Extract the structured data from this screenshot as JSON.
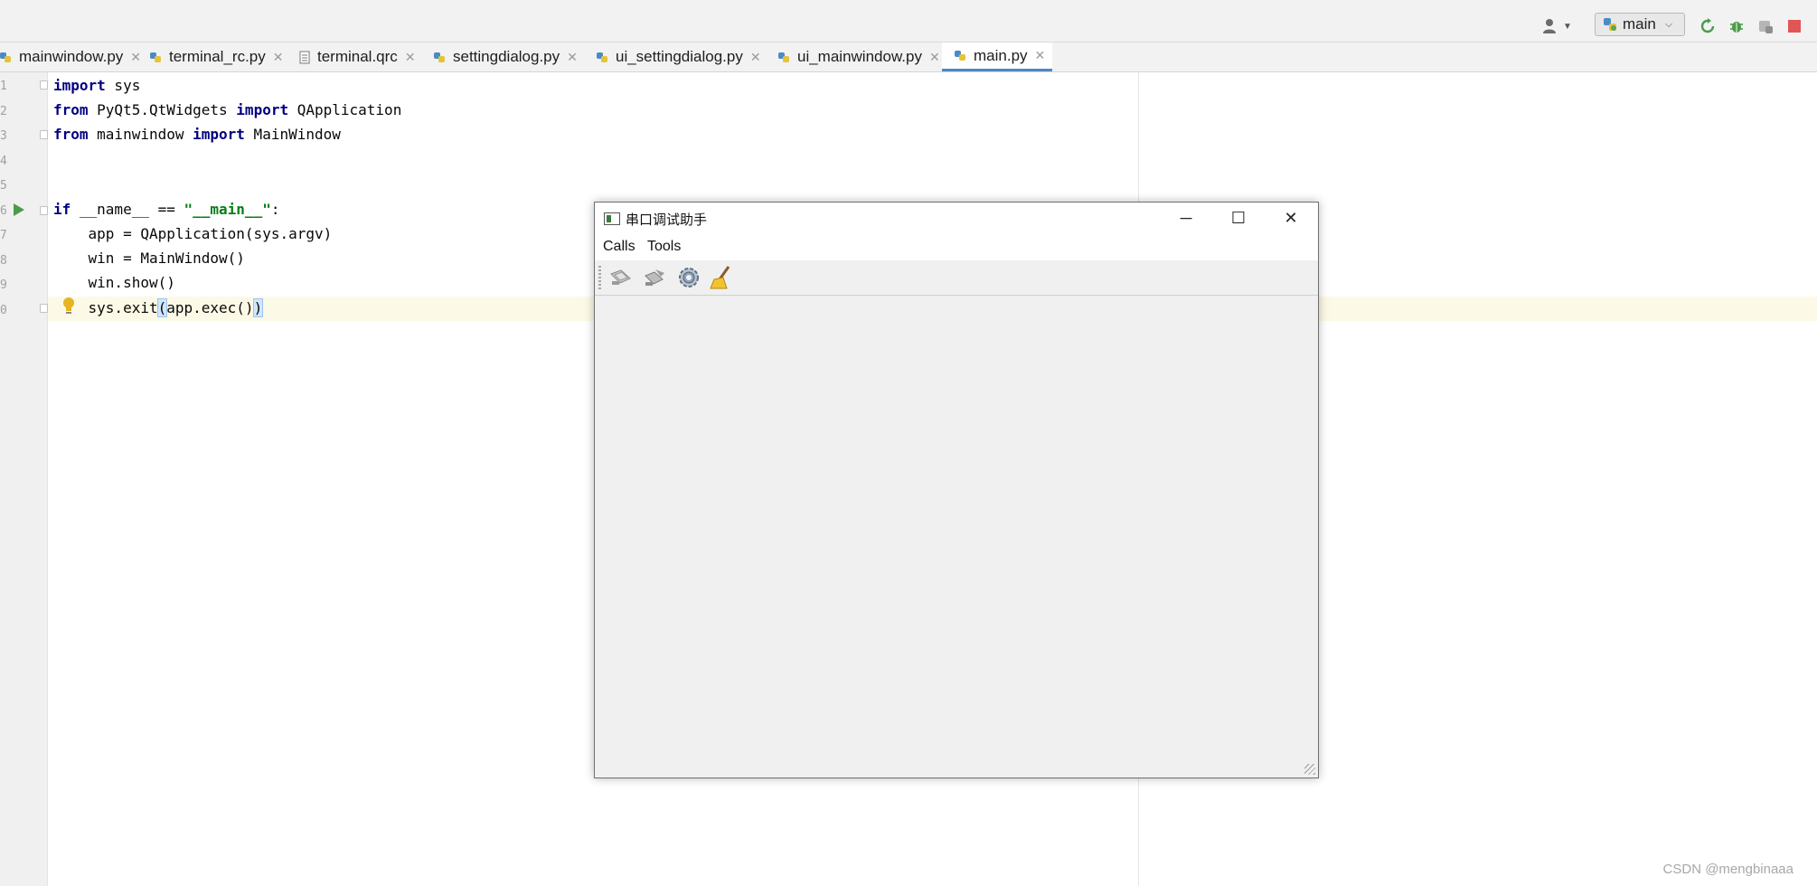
{
  "ide": {
    "run_config": "main",
    "icons": {
      "user": "user-icon",
      "config": "python-icon",
      "rerun": "rerun-icon",
      "debug": "debug-icon",
      "profile": "profile-icon",
      "stop": "stop-icon",
      "run_gutter": "run-arrow-icon",
      "bulb": "lightbulb-icon"
    }
  },
  "tabs": [
    {
      "label": "mainwindow.py",
      "active": false
    },
    {
      "label": "terminal_rc.py",
      "active": false
    },
    {
      "label": "terminal.qrc",
      "active": false
    },
    {
      "label": "settingdialog.py",
      "active": false
    },
    {
      "label": "ui_settingdialog.py",
      "active": false
    },
    {
      "label": "ui_mainwindow.py",
      "active": false
    },
    {
      "label": "main.py",
      "active": true
    }
  ],
  "gutter_numbers": [
    "1",
    "2",
    "3",
    "4",
    "5",
    "6",
    "7",
    "8",
    "9",
    "0"
  ],
  "code": {
    "l1": {
      "kw": "import",
      "rest": " sys"
    },
    "l2": {
      "kw1": "from",
      "mid": " PyQt5.QtWidgets ",
      "kw2": "import",
      "rest": " QApplication"
    },
    "l3": {
      "kw1": "from",
      "mid": " mainwindow ",
      "kw2": "import",
      "rest": " MainWindow"
    },
    "l6": {
      "kw": "if",
      "mid": " __name__ == ",
      "str": "\"__main__\"",
      "rest": ":"
    },
    "l7": "    app = QApplication(sys.argv)",
    "l8": "    win = MainWindow()",
    "l9": "    win.show()",
    "l10": {
      "pre": "    sys.exit",
      "open": "(",
      "mid": "app.exec()",
      "close": ")"
    }
  },
  "app_window": {
    "title": "串口调试助手",
    "menu": [
      "Calls",
      "Tools"
    ],
    "toolbar_icons": [
      "connect-icon",
      "disconnect-icon",
      "settings-gear-icon",
      "clear-broom-icon"
    ],
    "buttons": {
      "minimize": "─",
      "maximize": "☐",
      "close": "✕"
    }
  },
  "watermark": "CSDN @mengbinaaa",
  "colors": {
    "accent_tab": "#4a88c7",
    "stop": "#e05555",
    "run": "#4a9c4a"
  }
}
